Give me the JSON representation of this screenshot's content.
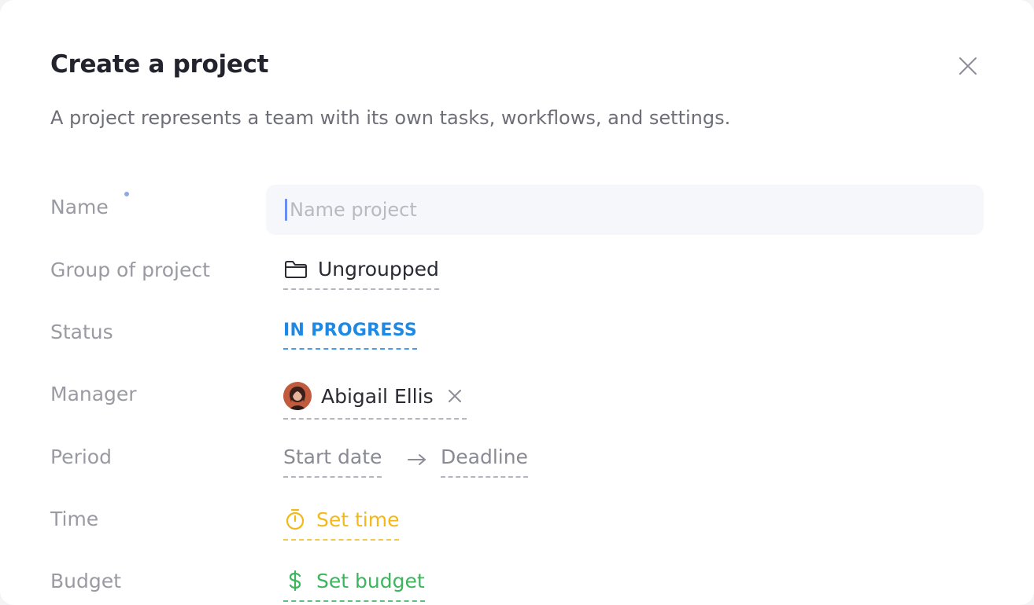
{
  "modal": {
    "title": "Create a project",
    "subtitle": "A project represents a team with its own tasks, workflows, and settings.",
    "close_icon": "close-icon"
  },
  "form": {
    "name": {
      "label": "Name",
      "placeholder": "Name project",
      "value": ""
    },
    "group": {
      "label": "Group of project",
      "value": "Ungroupped",
      "icon": "folder-icon"
    },
    "status": {
      "label": "Status",
      "value": "IN PROGRESS",
      "color": "#1e88e5"
    },
    "manager": {
      "label": "Manager",
      "value": "Abigail Ellis",
      "clear_icon": "close-icon"
    },
    "period": {
      "label": "Period",
      "start": "Start date",
      "end": "Deadline",
      "arrow_icon": "arrow-right-icon"
    },
    "time": {
      "label": "Time",
      "value": "Set time",
      "icon": "stopwatch-icon",
      "color": "#f2b919"
    },
    "budget": {
      "label": "Budget",
      "value": "Set budget",
      "icon": "dollar-icon",
      "color": "#3db45e"
    }
  }
}
